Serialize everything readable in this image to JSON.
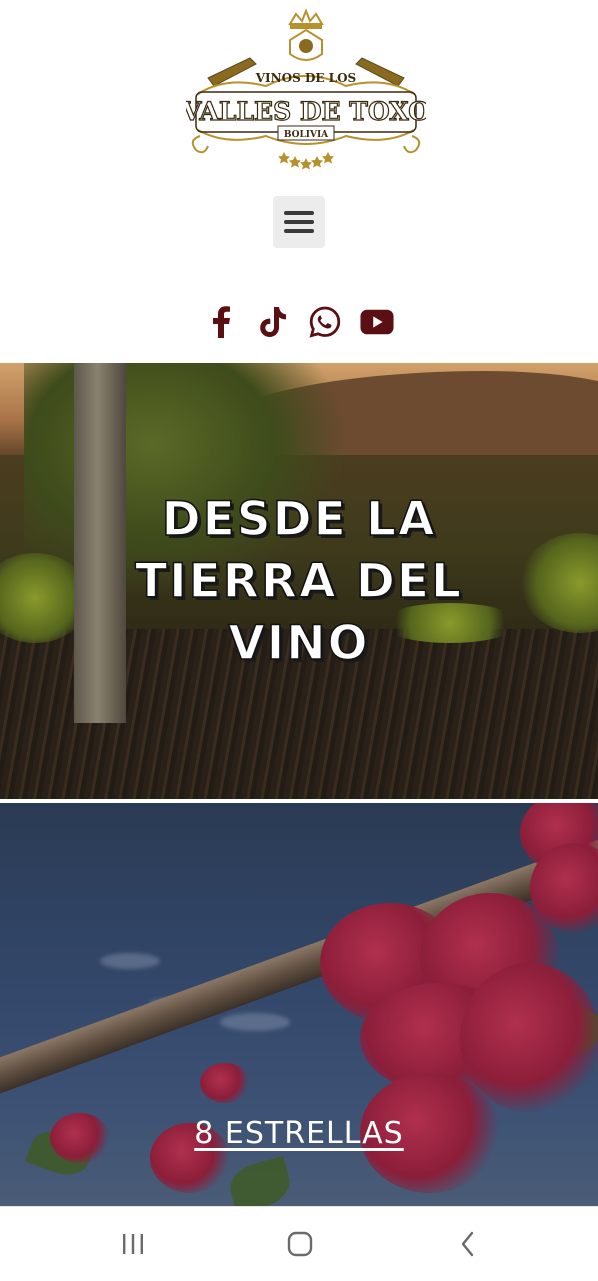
{
  "header": {
    "logo": {
      "line1": "VINOS DE LOS",
      "line2": "VALLES DE TOXO",
      "line3": "BOLIVIA"
    },
    "menu_icon": "hamburger-icon"
  },
  "socials": [
    {
      "name": "facebook",
      "icon": "facebook-icon"
    },
    {
      "name": "tiktok",
      "icon": "tiktok-icon"
    },
    {
      "name": "whatsapp",
      "icon": "whatsapp-icon"
    },
    {
      "name": "youtube",
      "icon": "youtube-icon"
    }
  ],
  "hero": {
    "title_line1": "DESDE LA",
    "title_line2": "TIERRA DEL",
    "title_line3": "VINO"
  },
  "banner": {
    "cta_label": "8 ESTRELLAS"
  },
  "colors": {
    "social_icon": "#5a0f12",
    "logo_gold": "#b8912f",
    "menu_bg": "#ececec"
  },
  "system_nav": {
    "recent": "recent-apps-icon",
    "home": "home-icon",
    "back": "back-icon"
  }
}
